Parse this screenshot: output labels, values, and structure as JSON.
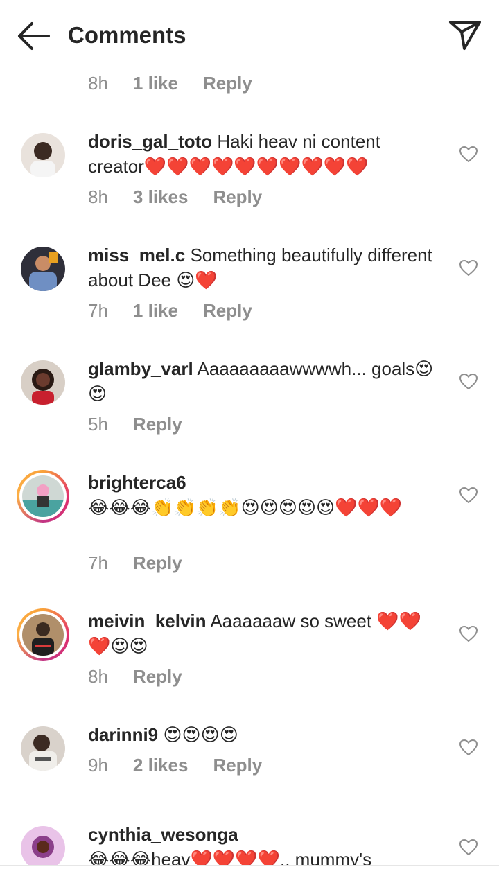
{
  "header": {
    "title": "Comments",
    "back_icon": "arrow-left-icon",
    "send_icon": "send-icon"
  },
  "top_meta": {
    "time": "8h",
    "likes": "1 like",
    "reply": "Reply"
  },
  "comments": [
    {
      "username": "doris_gal_toto",
      "text": "Haki heav ni content creator❤️❤️❤️❤️❤️❤️❤️❤️❤️❤️",
      "time": "8h",
      "likes": "3 likes",
      "reply": "Reply",
      "avatar_color": "#c9b8a8"
    },
    {
      "username": "miss_mel.c",
      "text": "Something beautifully different about Dee 😍❤️",
      "time": "7h",
      "likes": "1 like",
      "reply": "Reply",
      "avatar_color": "#8a6a55"
    },
    {
      "username": "glamby_varl",
      "text": "Aaaaaaaaawwwwh... goals😍😍",
      "time": "5h",
      "likes": "",
      "reply": "Reply",
      "avatar_color": "#6b3b2e"
    },
    {
      "username": "brighterca6",
      "text": "😂😂😂👏👏👏👏😍😍😍😍😍❤️❤️❤️",
      "time": "7h",
      "likes": "",
      "reply": "Reply",
      "avatar_color": "#7c9a8a"
    },
    {
      "username": "meivin_kelvin",
      "text": "Aaaaaaaw so sweet ❤️❤️❤️😍😍",
      "time": "8h",
      "likes": "",
      "reply": "Reply",
      "avatar_color": "#5c4a3a"
    },
    {
      "username": "darinni9",
      "text": "😍😍😍😍",
      "time": "9h",
      "likes": "2 likes",
      "reply": "Reply",
      "avatar_color": "#b9aea3"
    },
    {
      "username": "cynthia_wesonga",
      "text": "😂😂😂heav❤️❤️❤️❤️,, mummy's",
      "time": "",
      "likes": "",
      "reply": "",
      "avatar_color": "#9b4f8f"
    }
  ],
  "colors": {
    "text": "#262626",
    "muted": "#8e8e8e",
    "heart_red": "#ed1c24"
  }
}
